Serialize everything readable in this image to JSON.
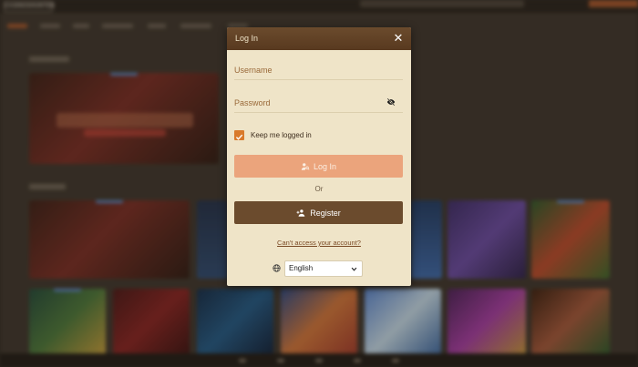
{
  "background": {
    "logo_text": "CASINOSHUNTER"
  },
  "modal": {
    "title": "Log In",
    "close_icon": "close-icon",
    "username_placeholder": "Username",
    "password_placeholder": "Password",
    "password_toggle_icon": "eye-off-icon",
    "remember_label": "Keep me logged in",
    "remember_checked": true,
    "login_button_label": "Log In",
    "login_icon": "user-key-icon",
    "or_text": "Or",
    "register_button_label": "Register",
    "register_icon": "user-plus-icon",
    "forgot_link": "Can't access your account?",
    "language_icon": "globe-icon",
    "language_selected": "English"
  },
  "colors": {
    "header": "#5e3f23",
    "modal_bg": "#efe4c8",
    "login_button": "#eba47c",
    "register_button": "#6b4b2d",
    "checkbox": "#d97a2b"
  }
}
